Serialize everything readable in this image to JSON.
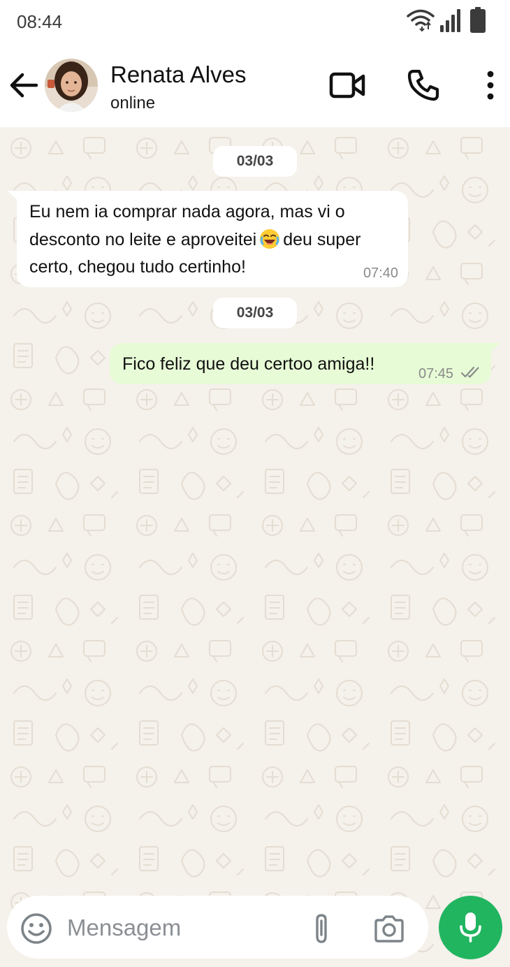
{
  "status_bar": {
    "time": "08:44",
    "icons": [
      "wifi-icon",
      "signal-icon",
      "battery-icon"
    ]
  },
  "header": {
    "back_icon": "arrow-left-icon",
    "contact_name": "Renata Alves",
    "contact_status": "online",
    "actions": [
      "video-call-icon",
      "phone-icon",
      "more-vertical-icon"
    ]
  },
  "chat": {
    "messages": [
      {
        "date": "03/03",
        "direction": "incoming",
        "text_before_emoji": "Eu nem ia comprar nada agora, mas vi o desconto no leite e aproveitei",
        "emoji": "😂",
        "text_after_emoji": "deu super certo, chegou tudo certinho!",
        "time": "07:40"
      },
      {
        "date": "03/03",
        "direction": "outgoing",
        "text": "Fico feliz que deu certoo amiga!!",
        "time": "07:45",
        "status_icon": "double-check-icon"
      }
    ]
  },
  "input_bar": {
    "placeholder": "Mensagem",
    "icons": [
      "emoji-icon",
      "paperclip-icon",
      "camera-icon",
      "microphone-icon"
    ]
  },
  "colors": {
    "chat_background": "#f5f1eb",
    "incoming_bubble": "#ffffff",
    "outgoing_bubble": "#e7fcd6",
    "accent_green": "#21b560"
  }
}
